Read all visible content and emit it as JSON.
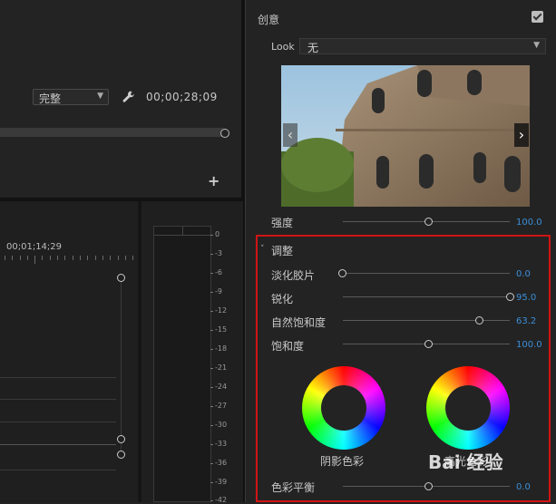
{
  "program_monitor": {
    "quality": "完整",
    "timecode": "00;00;28;09"
  },
  "timeline": {
    "time_label": "00;01;14;29"
  },
  "audio_meter": {
    "scale": [
      "0",
      "-3",
      "-6",
      "-9",
      "-12",
      "-15",
      "-18",
      "-21",
      "-24",
      "-27",
      "-30",
      "-33",
      "-36",
      "-39",
      "-42"
    ]
  },
  "lumetri": {
    "creative_title": "创意",
    "look_label": "Look",
    "look_value": "无",
    "intensity_label": "强度",
    "intensity_value": "100.0",
    "adjust_title": "调整",
    "faded_film_label": "淡化胶片",
    "faded_film_value": "0.0",
    "sharpen_label": "锐化",
    "sharpen_value": "95.0",
    "vibrance_label": "自然饱和度",
    "vibrance_value": "63.2",
    "saturation_label": "饱和度",
    "saturation_value": "100.0",
    "shadow_tint_label": "阴影色彩",
    "highlight_tint_label": "高光色彩",
    "color_balance_label": "色彩平衡",
    "color_balance_value": "0.0"
  },
  "watermark": "Bai 经验",
  "colors": {
    "accent_value": "#3b8fd9",
    "highlight_box": "#d11414"
  }
}
